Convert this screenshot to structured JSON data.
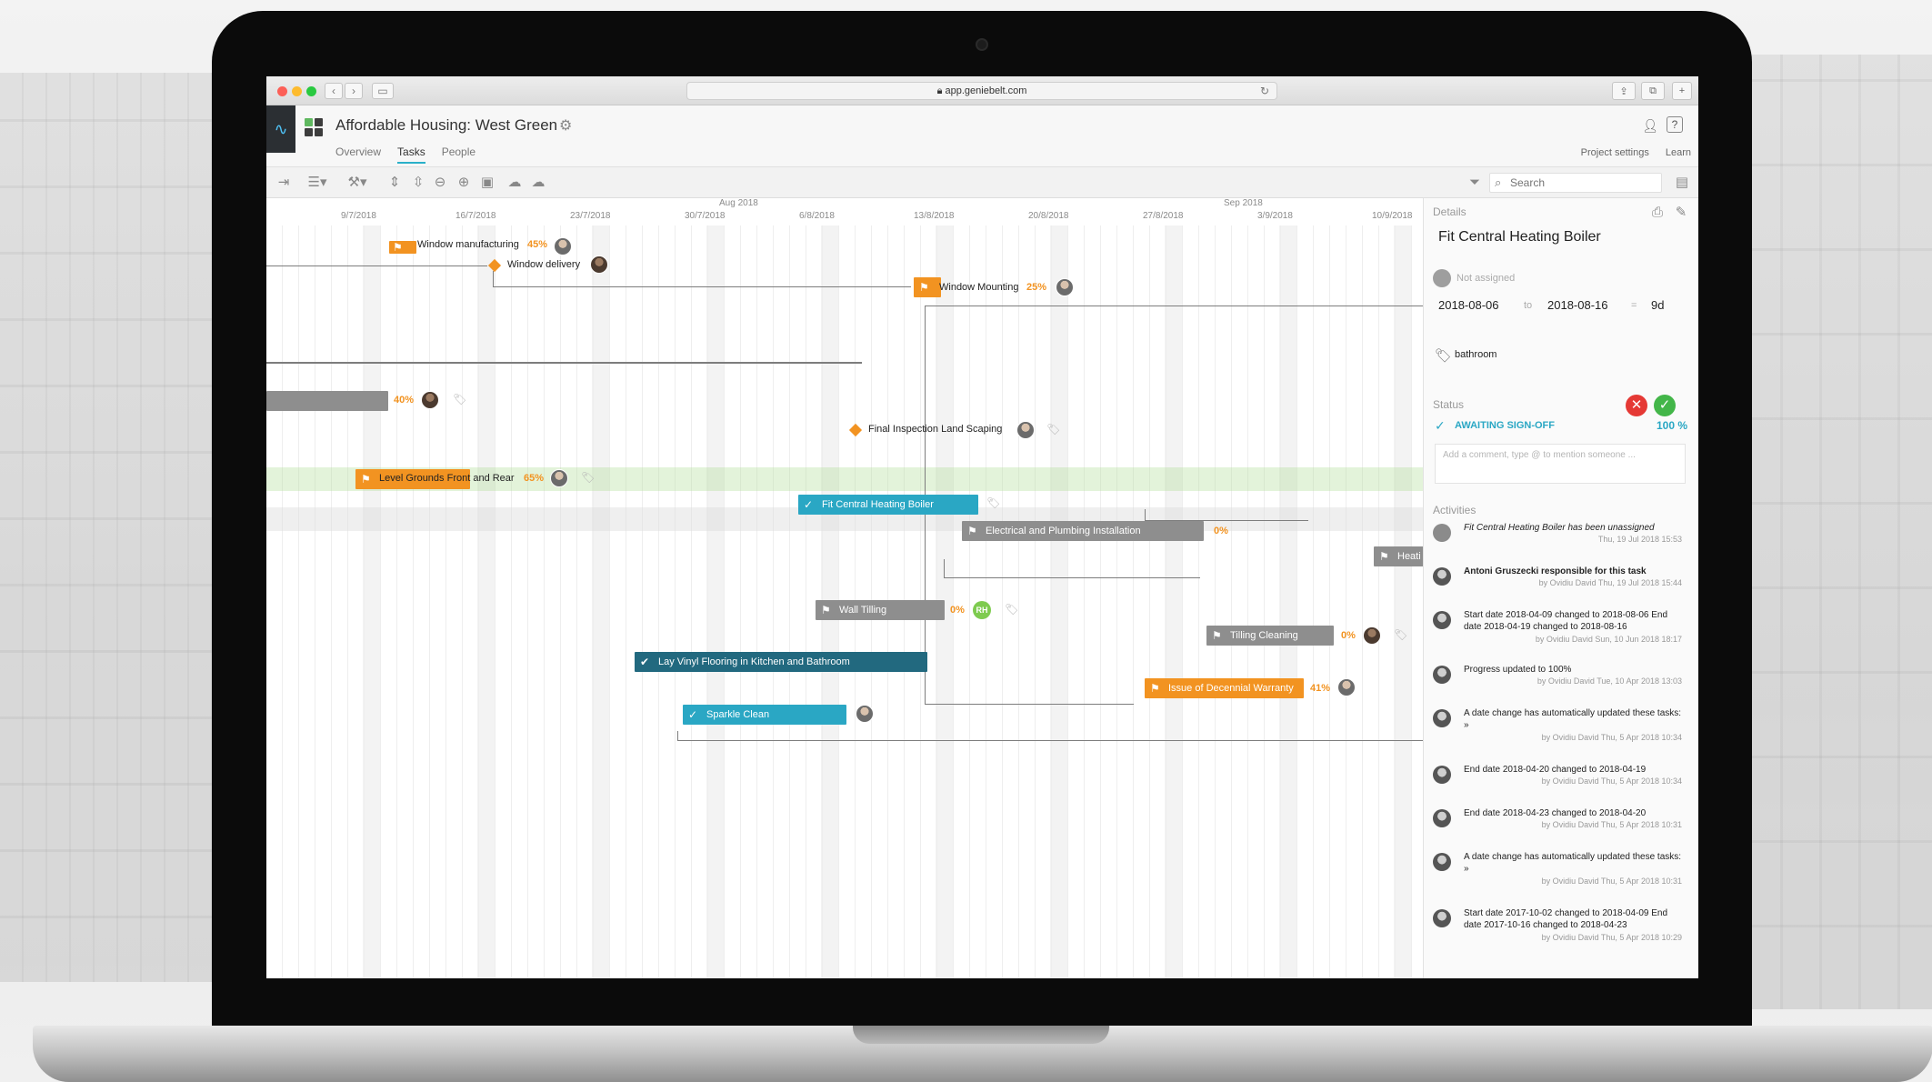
{
  "browser": {
    "url": "app.geniebelt.com"
  },
  "app": {
    "project_title": "Affordable Housing: West Green",
    "tabs": [
      "Overview",
      "Tasks",
      "People"
    ],
    "active_tab": "Tasks",
    "header_links": [
      "Project settings",
      "Learn"
    ]
  },
  "toolbar": {
    "search_placeholder": "Search"
  },
  "timeline": {
    "months": [
      {
        "label": "Aug 2018"
      },
      {
        "label": "Sep 2018"
      }
    ],
    "weeks": [
      "9/7/2018",
      "16/7/2018",
      "23/7/2018",
      "30/7/2018",
      "6/8/2018",
      "13/8/2018",
      "20/8/2018",
      "27/8/2018",
      "3/9/2018",
      "10/9/2018"
    ]
  },
  "tasks": {
    "window_manufacturing": {
      "label": "Window manufacturing",
      "pct": "45%"
    },
    "window_delivery": {
      "label": "Window delivery"
    },
    "window_mounting": {
      "label": "Window Mounting",
      "pct": "25%"
    },
    "unnamed_grey": {
      "pct": "40%"
    },
    "final_inspection": {
      "label": "Final Inspection Land Scaping"
    },
    "level_grounds": {
      "label": "Level Grounds Front and Rear",
      "pct": "65%"
    },
    "fit_central_heating": {
      "label": "Fit Central Heating Boiler"
    },
    "electrical_plumbing": {
      "label": "Electrical and Plumbing Installation",
      "pct": "0%"
    },
    "heating_partial": {
      "label": "Heati"
    },
    "wall_tilling": {
      "label": "Wall Tilling",
      "pct": "0%",
      "assignee_initials": "RH"
    },
    "tilling_cleaning": {
      "label": "Tilling Cleaning",
      "pct": "0%"
    },
    "lay_vinyl": {
      "label": "Lay Vinyl Flooring in Kitchen and Bathroom"
    },
    "decennial_warranty": {
      "label": "Issue of Decennial Warranty",
      "pct": "41%"
    },
    "sparkle_clean": {
      "label": "Sparkle Clean"
    }
  },
  "details": {
    "section_label": "Details",
    "task_title": "Fit Central Heating Boiler",
    "assignee": "Not assigned",
    "start_date": "2018-08-06",
    "to_label": "to",
    "end_date": "2018-08-16",
    "dash": "=",
    "duration": "9d",
    "tag": "bathroom",
    "status_label": "Status",
    "status_value": "AWAITING SIGN-OFF",
    "status_pct": "100 %",
    "comment_placeholder": "Add a comment, type @ to mention someone ...",
    "activities_label": "Activities",
    "activities": [
      {
        "text": "Fit Central Heating Boiler has been unassigned",
        "meta": "Thu, 19 Jul 2018 15:53"
      },
      {
        "text": "Antoni Gruszecki responsible for this task",
        "meta": "by Ovidiu David Thu, 19 Jul 2018 15:44"
      },
      {
        "text": "Start date 2018-04-09 changed to 2018-08-06 End date 2018-04-19 changed to 2018-08-16",
        "meta": "by Ovidiu David Sun, 10 Jun 2018 18:17"
      },
      {
        "text": "Progress updated to 100%",
        "meta": "by Ovidiu David Tue, 10 Apr 2018 13:03"
      },
      {
        "text": "A date change has automatically updated these tasks: »",
        "meta": "by Ovidiu David Thu, 5 Apr 2018 10:34"
      },
      {
        "text": "End date 2018-04-20 changed to 2018-04-19",
        "meta": "by Ovidiu David Thu, 5 Apr 2018 10:34"
      },
      {
        "text": "End date 2018-04-23 changed to 2018-04-20",
        "meta": "by Ovidiu David Thu, 5 Apr 2018 10:31"
      },
      {
        "text": "A date change has automatically updated these tasks: »",
        "meta": "by Ovidiu David Thu, 5 Apr 2018 10:31"
      },
      {
        "text": "Start date 2017-10-02 changed to 2018-04-09 End date 2017-10-16 changed to 2018-04-23",
        "meta": "by Ovidiu David Thu, 5 Apr 2018 10:29"
      }
    ]
  },
  "icons": {
    "pulse": "pulse-icon",
    "gear": "gear-icon",
    "search": "search-icon",
    "filter": "filter-icon",
    "flag": "flag-icon",
    "tag": "tag-icon"
  },
  "colors": {
    "accent_teal": "#2aa7c4",
    "task_orange": "#f29321",
    "task_grey": "#8e8e8e",
    "status_green": "#43b649",
    "status_red": "#e53935"
  }
}
